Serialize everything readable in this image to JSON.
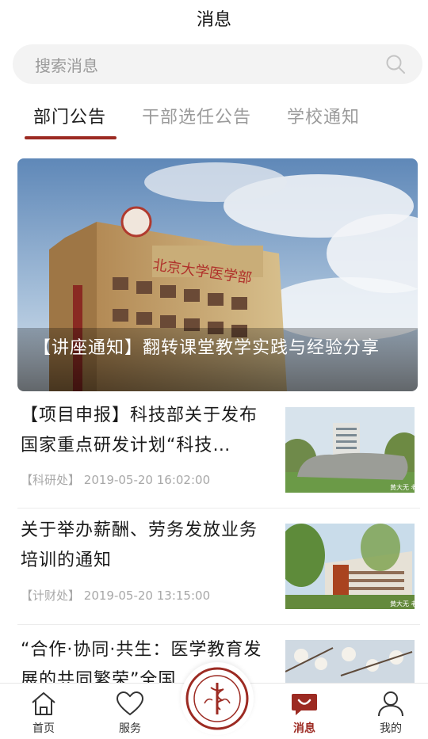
{
  "header": {
    "title": "消息"
  },
  "search": {
    "placeholder": "搜索消息"
  },
  "tabs": [
    {
      "label": "部门公告",
      "active": true
    },
    {
      "label": "干部选任公告",
      "active": false
    },
    {
      "label": "学校通知",
      "active": false
    }
  ],
  "banner": {
    "caption": "【讲座通知】翻转课堂教学实践与经验分享",
    "building_sign": "北京大学医学部"
  },
  "news": [
    {
      "title": "【项目申报】科技部关于发布国家重点研发计划“科技…",
      "department": "【科研处】",
      "datetime": "2019-05-20 16:02:00",
      "thumb_caption": "黄大无 老"
    },
    {
      "title": "关于举办薪酬、劳务发放业务培训的通知",
      "department": "【计财处】",
      "datetime": "2019-05-20 13:15:00",
      "thumb_caption": "黄大无 老"
    },
    {
      "title": "“合作·协同·共生：医学教育发展的共同繁荣”全国…",
      "department": "",
      "datetime": ""
    }
  ],
  "tabbar": [
    {
      "label": "首页",
      "icon": "home-icon",
      "active": false
    },
    {
      "label": "服务",
      "icon": "heart-icon",
      "active": false
    },
    {
      "label": "消息",
      "icon": "message-icon",
      "active": true
    },
    {
      "label": "我的",
      "icon": "person-icon",
      "active": false
    }
  ],
  "colors": {
    "accent": "#9c2a22",
    "placeholder": "#9a9a9a",
    "meta": "#a8a8a8"
  }
}
